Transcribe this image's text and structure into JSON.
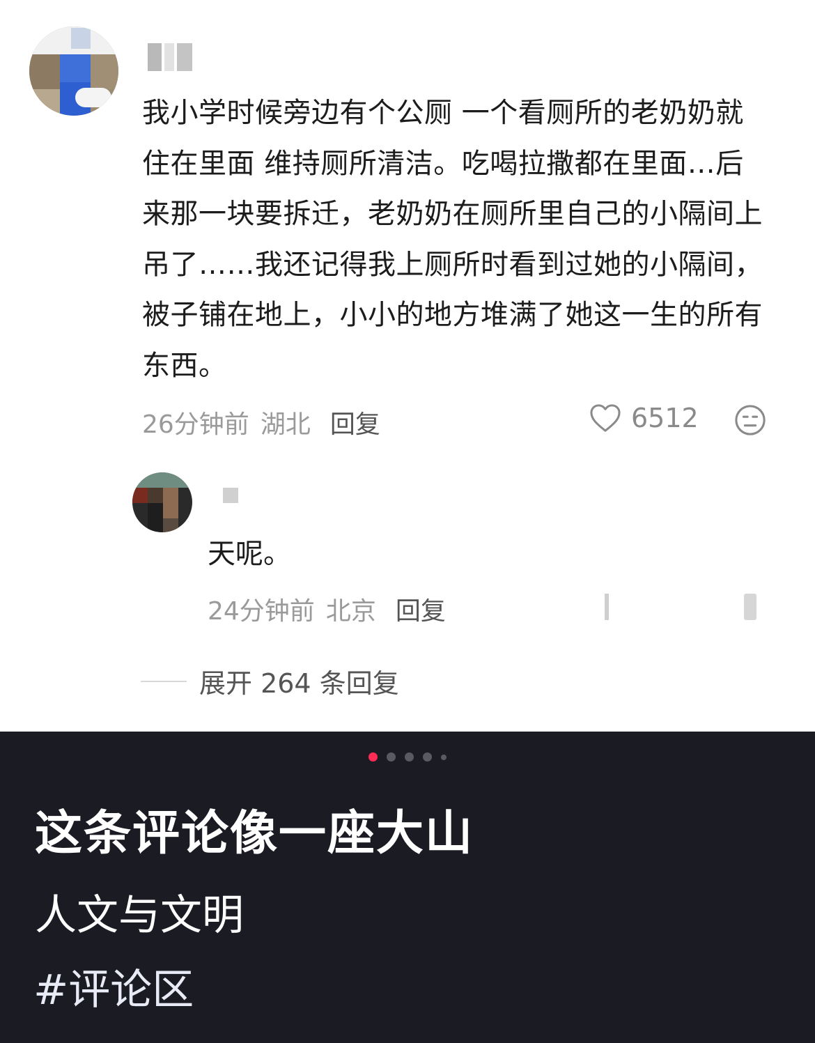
{
  "comment": {
    "text": "我小学时候旁边有个公厕 一个看厕所的老奶奶就住在里面 维持厕所清洁。吃喝拉撒都在里面…后来那一块要拆迁，老奶奶在厕所里自己的小隔间上吊了……我还记得我上厕所时看到过她的小隔间，被子铺在地上，小小的地方堆满了她这一生的所有东西。",
    "time": "26分钟前",
    "location": "湖北",
    "reply_label": "回复",
    "like_count": "6512",
    "icons": {
      "like": "heart-icon",
      "dislike": "meh-face-icon"
    }
  },
  "reply": {
    "text": "天呢。",
    "time": "24分钟前",
    "location": "北京",
    "reply_label": "回复"
  },
  "expand_replies": {
    "label": "展开 264 条回复"
  },
  "panel": {
    "pagination": {
      "total": 5,
      "active_index": 0,
      "active_color": "#fe2c55"
    },
    "title": "这条评论像一座大山",
    "subtitle": "人文与文明",
    "hashtag": "#评论区"
  }
}
